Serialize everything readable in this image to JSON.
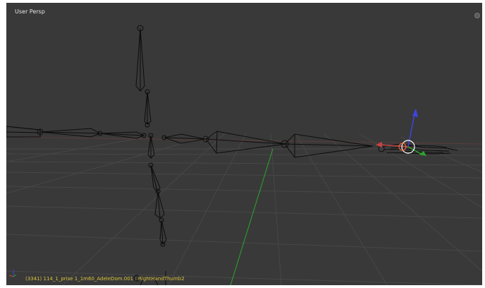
{
  "viewport": {
    "view_label": "User Persp",
    "object_info": "(3341) 114_1_prise 1_1m60_AdeleDom.001 : RightHandThumb2"
  },
  "colors": {
    "background": "#393939",
    "grid": "#474747",
    "x_axis": "#c24545",
    "y_axis": "#2da52d",
    "z_axis": "#3d45e0",
    "bone_wire": "#0d0d0d",
    "text": "#e6e6e6",
    "info_text": "#d8c23c"
  },
  "icons": {
    "axes_gizmo": "axes-icon",
    "manipulator": "transform-manipulator-icon",
    "nav_dot": "view-navigation-icon"
  }
}
